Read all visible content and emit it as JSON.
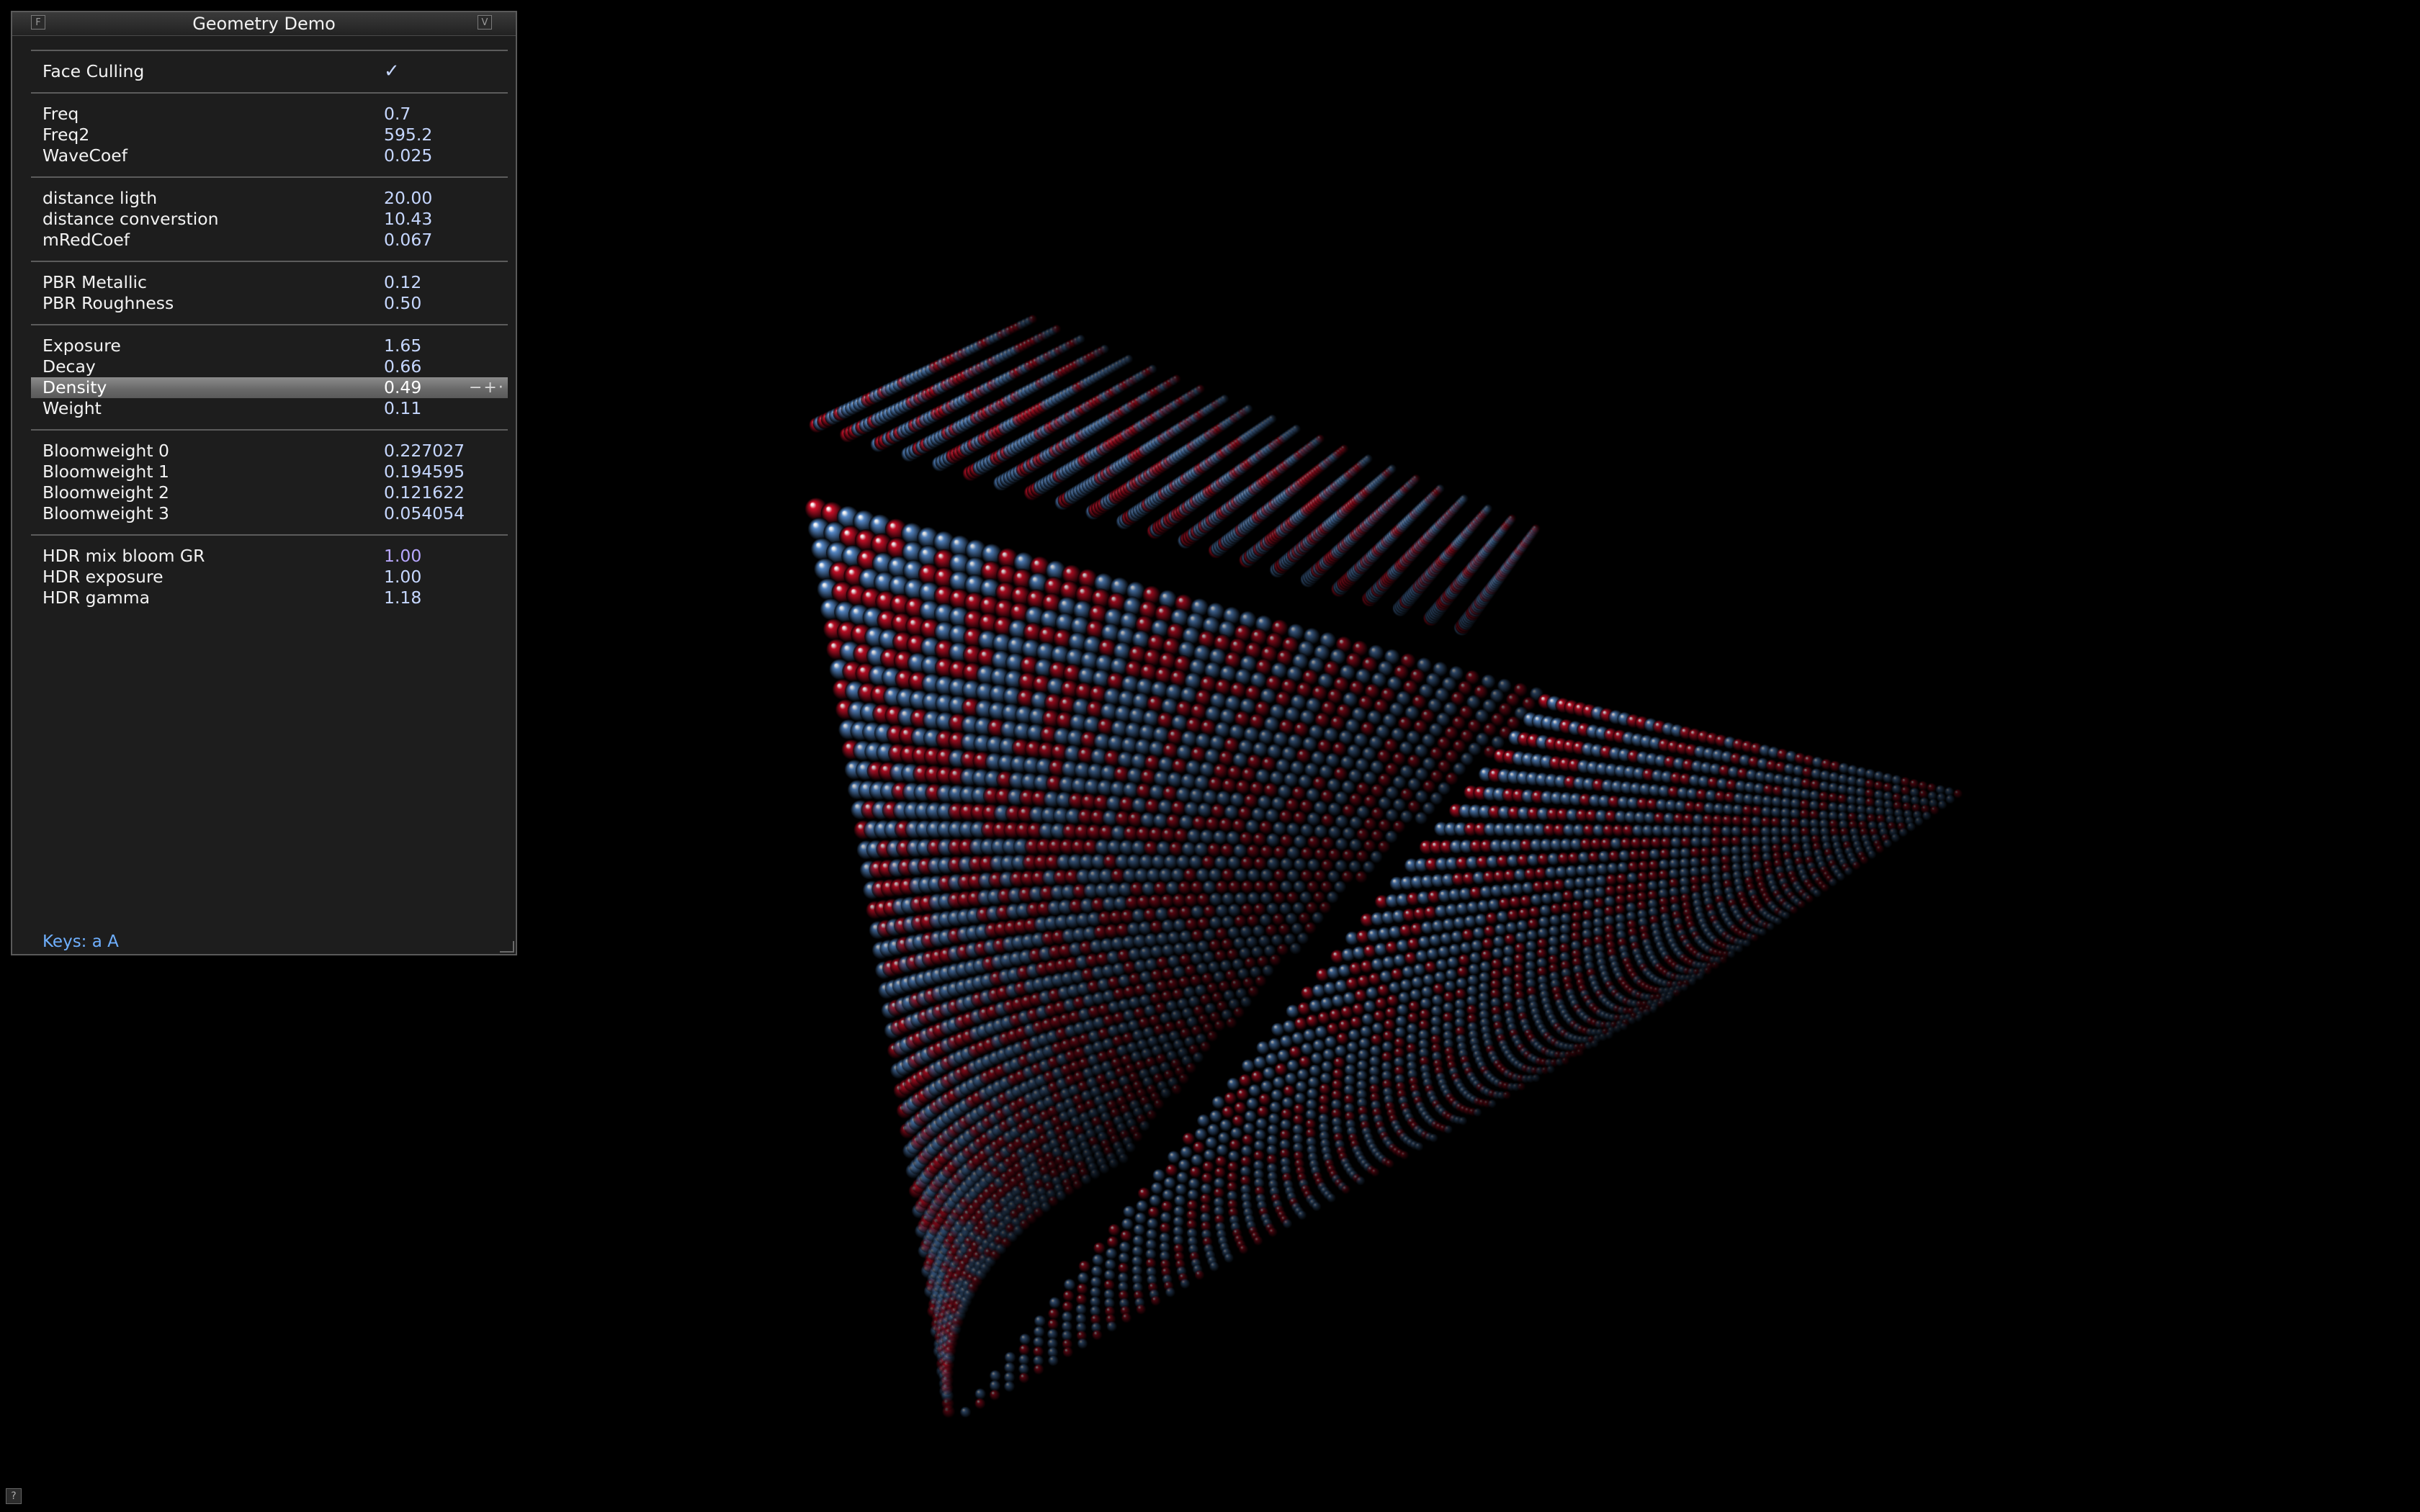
{
  "panel": {
    "title": "Geometry Demo",
    "iconify_label": "F",
    "close_label": "V",
    "keys": "Keys: a  A",
    "groups": [
      {
        "rows": [
          {
            "label": "Face Culling",
            "check": "✓"
          }
        ]
      },
      {
        "rows": [
          {
            "label": "Freq",
            "value": "0.7"
          },
          {
            "label": "Freq2",
            "value": "595.2"
          },
          {
            "label": "WaveCoef",
            "value": "0.025"
          }
        ]
      },
      {
        "rows": [
          {
            "label": "distance ligth",
            "value": "20.00"
          },
          {
            "label": "distance converstion",
            "value": "10.43"
          },
          {
            "label": "mRedCoef",
            "value": "0.067"
          }
        ]
      },
      {
        "rows": [
          {
            "label": "PBR Metallic",
            "value": "0.12"
          },
          {
            "label": "PBR Roughness",
            "value": "0.50"
          }
        ]
      },
      {
        "rows": [
          {
            "label": "Exposure",
            "value": "1.65"
          },
          {
            "label": "Decay",
            "value": "0.66"
          },
          {
            "label": "Density",
            "value": "0.49",
            "spinner": "−+·"
          },
          {
            "label": "Weight",
            "value": "0.11"
          }
        ]
      },
      {
        "rows": [
          {
            "label": "Bloomweight 0",
            "value": "0.227027"
          },
          {
            "label": "Bloomweight 1",
            "value": "0.194595"
          },
          {
            "label": "Bloomweight 2",
            "value": "0.121622"
          },
          {
            "label": "Bloomweight 3",
            "value": "0.054054"
          }
        ]
      },
      {
        "rows": [
          {
            "label": "HDR mix bloom GR",
            "value": "1.00"
          },
          {
            "label": "HDR exposure",
            "value": "1.00"
          },
          {
            "label": "HDR gamma",
            "value": "1.18"
          }
        ]
      }
    ]
  },
  "help_label": "?",
  "colors": {
    "red_sphere": "#d0102a",
    "blue_sphere": "#5b8fd0",
    "value_text": "#c6d7ff",
    "check": "#7dff72",
    "keys_text": "#6fb0ff"
  },
  "scene": {
    "description_icon": "wave-sphere-grid-icon"
  }
}
